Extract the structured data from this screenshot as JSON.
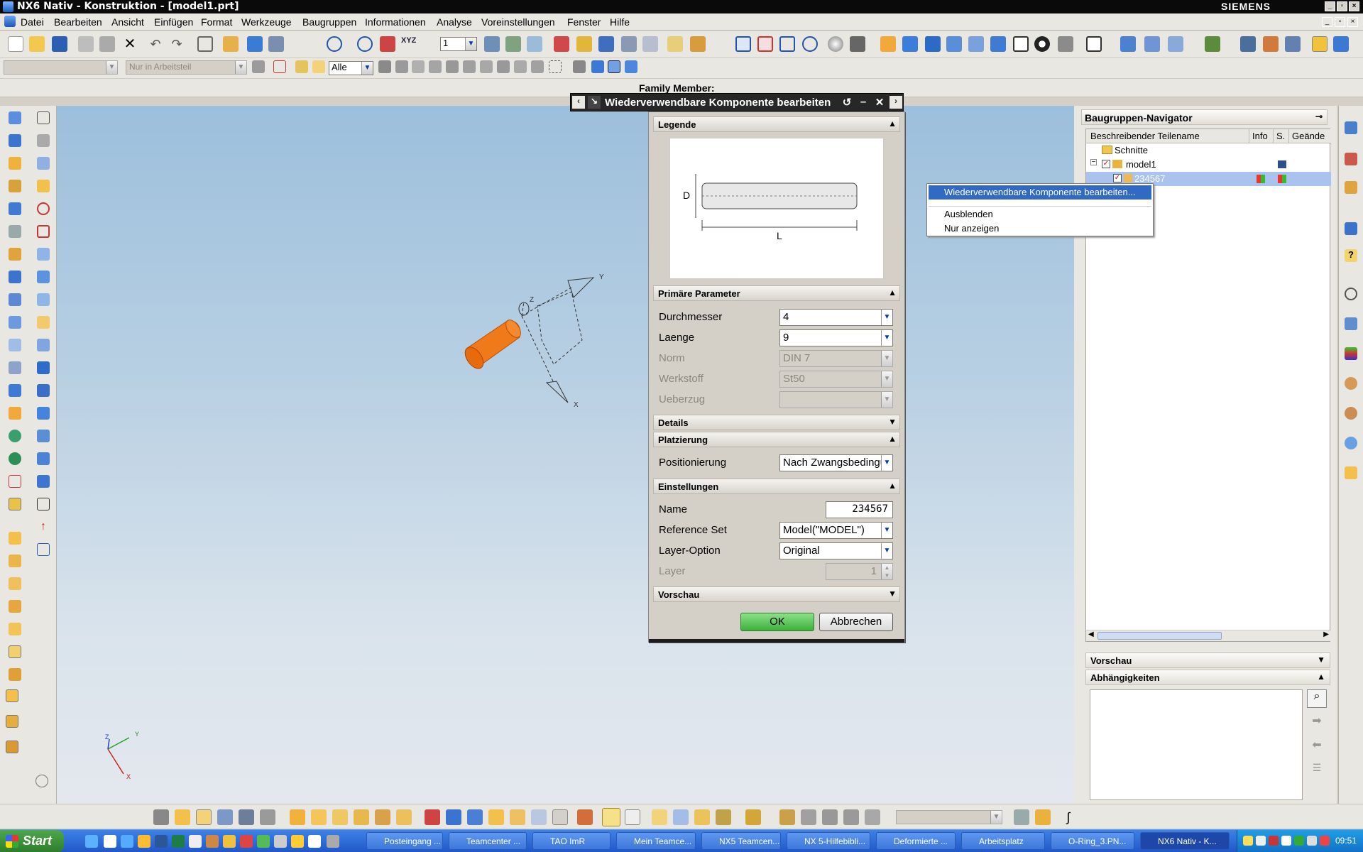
{
  "window": {
    "title": "NX6 Nativ - Konstruktion - [model1.prt]",
    "brand": "SIEMENS"
  },
  "menu": [
    "Datei",
    "Bearbeiten",
    "Ansicht",
    "Einfügen",
    "Format",
    "Werkzeuge",
    "Baugruppen",
    "Informationen",
    "Analyse",
    "Voreinstellungen",
    "Fenster",
    "Hilfe"
  ],
  "toolbar2": {
    "filter_placeholder": "Nur in Arbeitsteil",
    "select_value": "Alle",
    "layer_value": "1"
  },
  "family_member_label": "Family Member:",
  "dialog": {
    "title": "Wiederverwendbare Komponente bearbeiten",
    "sections": {
      "legend": "Legende",
      "primary": "Primäre Parameter",
      "details": "Details",
      "placement": "Platzierung",
      "settings": "Einstellungen",
      "preview": "Vorschau"
    },
    "legend_labels": {
      "d": "D",
      "l": "L"
    },
    "params": [
      {
        "label": "Durchmesser",
        "value": "4",
        "enabled": true
      },
      {
        "label": "Laenge",
        "value": "9",
        "enabled": true
      },
      {
        "label": "Norm",
        "value": "DIN 7",
        "enabled": false
      },
      {
        "label": "Werkstoff",
        "value": "St50",
        "enabled": false
      },
      {
        "label": "Ueberzug",
        "value": "",
        "enabled": false
      }
    ],
    "positioning": {
      "label": "Positionierung",
      "value": "Nach Zwangsbedingungen"
    },
    "settings": {
      "name_label": "Name",
      "name_value": "234567",
      "refset_label": "Reference Set",
      "refset_value": "Model(\"MODEL\")",
      "layeropt_label": "Layer-Option",
      "layeropt_value": "Original",
      "layer_label": "Layer",
      "layer_value": "1"
    },
    "ok": "OK",
    "cancel": "Abbrechen"
  },
  "navigator": {
    "title": "Baugruppen-Navigator",
    "columns": [
      "Beschreibender Teilename",
      "Info",
      "S.",
      "Geände"
    ],
    "rows": [
      {
        "name": "Schnitte"
      },
      {
        "name": "model1"
      },
      {
        "name": "234567"
      }
    ],
    "preview": "Vorschau",
    "dependencies": "Abhängigkeiten"
  },
  "context_menu": [
    "Wiederverwendbare Komponente bearbeiten...",
    "Ausblenden",
    "Nur anzeigen"
  ],
  "viewport": {
    "axes": {
      "x": "X",
      "y": "Y",
      "z": "Z"
    }
  },
  "taskbar": {
    "start": "Start",
    "tasks": [
      "Posteingang ...",
      "Teamcenter ...",
      "TAO ImR",
      "Mein Teamce...",
      "NX5 Teamcen...",
      "NX 5-Hilfebibli...",
      "Deformierte ...",
      "Arbeitsplatz",
      "O-Ring_3.PN...",
      "NX6 Nativ - K..."
    ],
    "clock": "09:51"
  },
  "colors": {
    "accent": "#316ac5",
    "part": "#f07a1a",
    "ok_button": "#5cc85a"
  }
}
